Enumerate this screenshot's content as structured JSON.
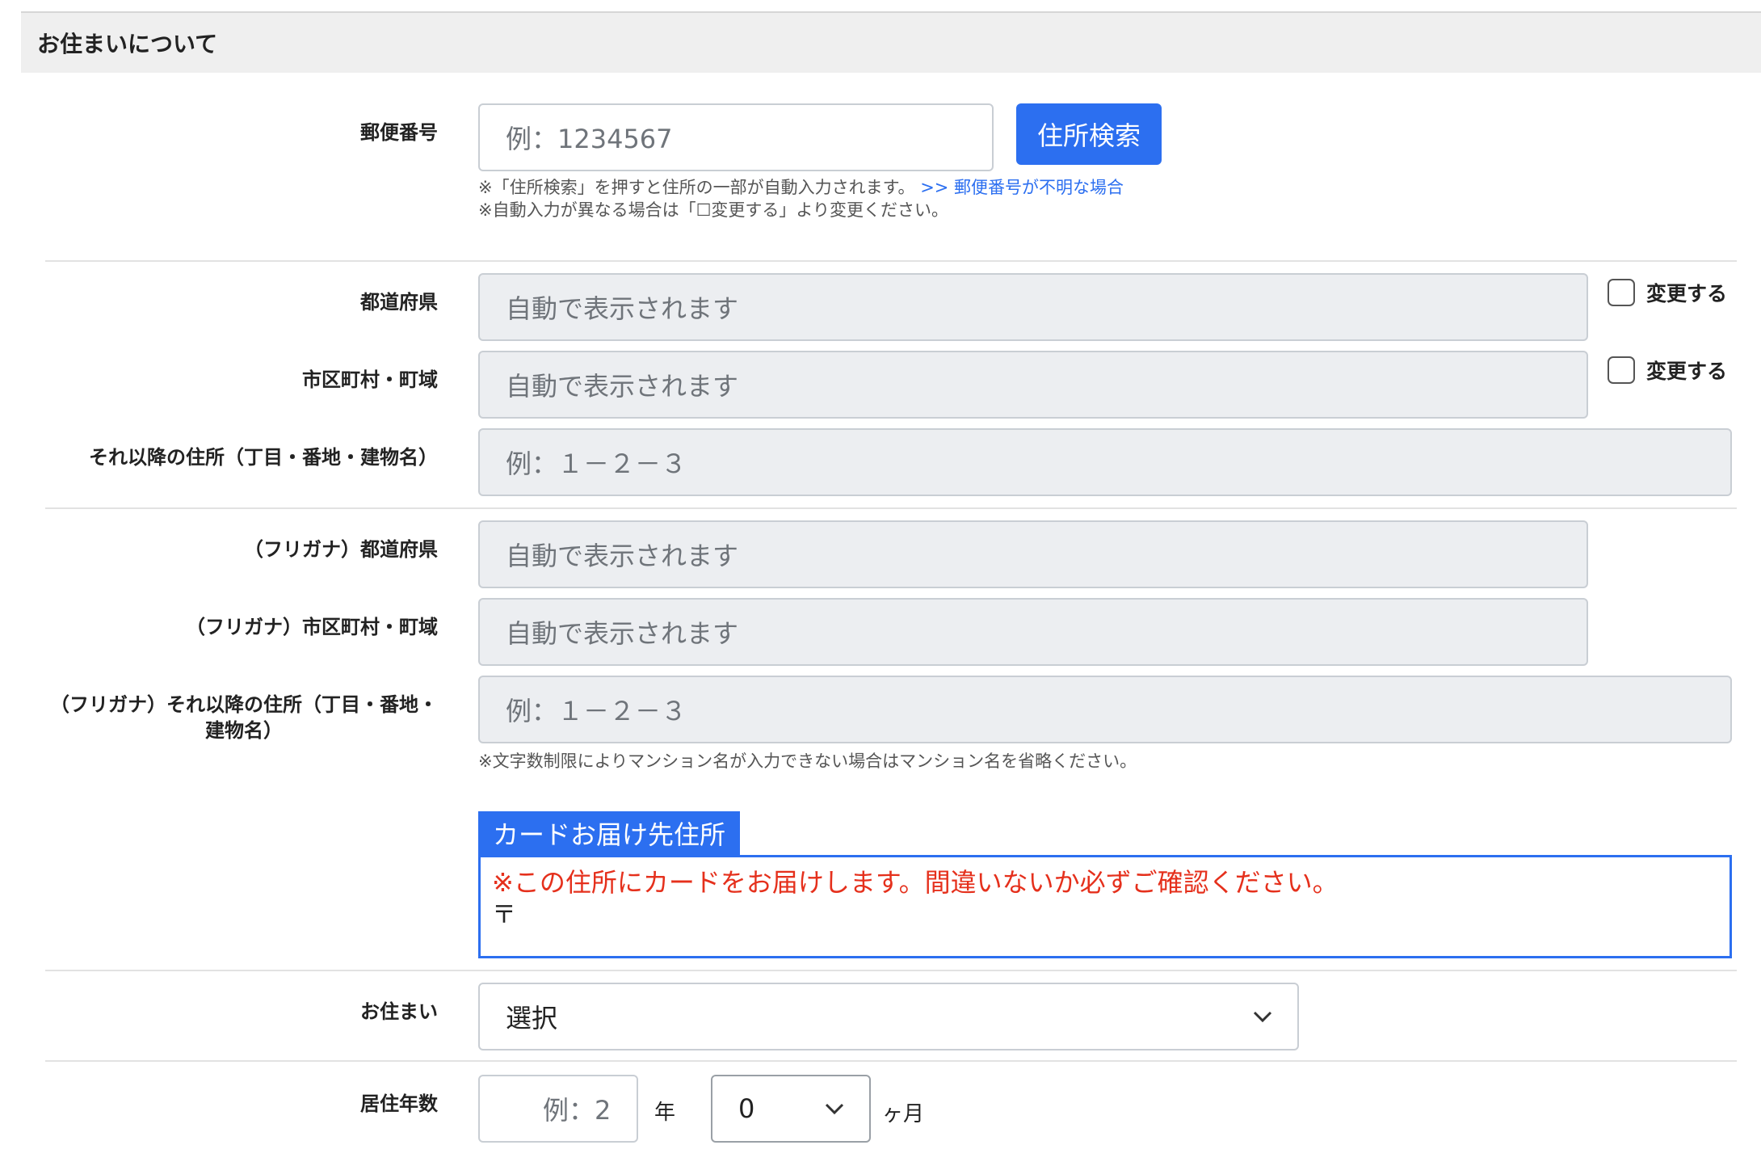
{
  "section": {
    "title": "お住まいについて"
  },
  "postal": {
    "label": "郵便番号",
    "placeholder": "例：1234567",
    "search_button": "住所検索",
    "note1": "※「住所検索」を押すと住所の一部が自動入力されます。",
    "note1_link": ">> 郵便番号が不明な場合",
    "note2": "※自動入力が異なる場合は「☐変更する」より変更ください。"
  },
  "address": {
    "prefecture_label": "都道府県",
    "prefecture_placeholder": "自動で表示されます",
    "city_label": "市区町村・町域",
    "city_placeholder": "自動で表示されます",
    "change_label": "変更する",
    "rest_label": "それ以降の住所（丁目・番地・建物名）",
    "rest_placeholder": "例：１－２－３"
  },
  "furigana": {
    "prefecture_label": "（フリガナ）都道府県",
    "prefecture_placeholder": "自動で表示されます",
    "city_label": "（フリガナ）市区町村・町域",
    "city_placeholder": "自動で表示されます",
    "rest_label": "（フリガナ）それ以降の住所（丁目・番地・建物名）",
    "rest_placeholder": "例：１－２－３",
    "note": "※文字数制限によりマンション名が入力できない場合はマンション名を省略ください。"
  },
  "card_address": {
    "tag": "カードお届け先住所",
    "warning": "※この住所にカードをお届けします。間違いないか必ずご確認ください。",
    "postal_mark": "〒"
  },
  "residence": {
    "label": "お住まい",
    "selected": "選択"
  },
  "years": {
    "label": "居住年数",
    "years_placeholder": "例：2",
    "years_unit": "年",
    "months_selected": "0",
    "months_unit": "ヶ月"
  },
  "colors": {
    "accent": "#2c6ff0",
    "warning": "#e5301c"
  }
}
